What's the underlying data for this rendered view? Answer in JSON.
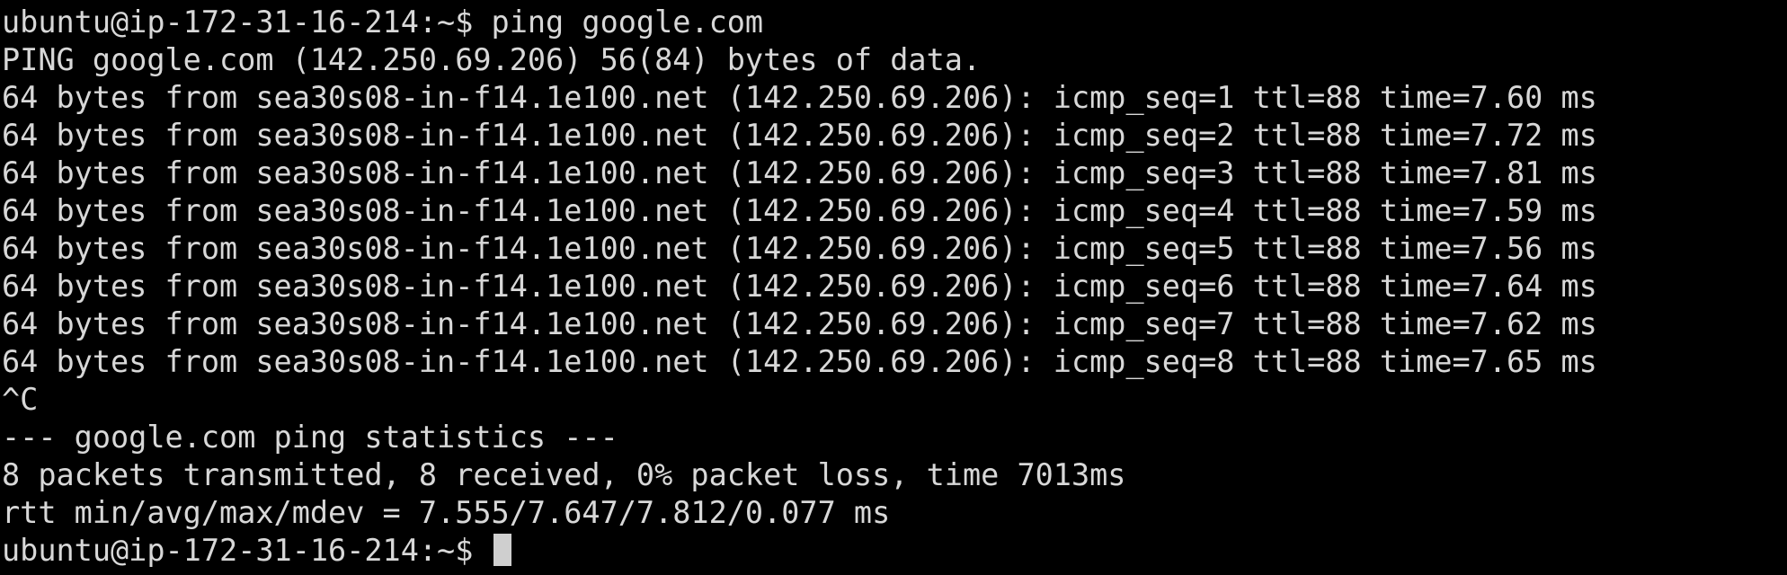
{
  "terminal": {
    "colors": {
      "background": "#000000",
      "foreground": "#d8d8d8",
      "cursor": "#cfcfcf"
    },
    "lines": [
      "ubuntu@ip-172-31-16-214:~$ ping google.com",
      "PING google.com (142.250.69.206) 56(84) bytes of data.",
      "64 bytes from sea30s08-in-f14.1e100.net (142.250.69.206): icmp_seq=1 ttl=88 time=7.60 ms",
      "64 bytes from sea30s08-in-f14.1e100.net (142.250.69.206): icmp_seq=2 ttl=88 time=7.72 ms",
      "64 bytes from sea30s08-in-f14.1e100.net (142.250.69.206): icmp_seq=3 ttl=88 time=7.81 ms",
      "64 bytes from sea30s08-in-f14.1e100.net (142.250.69.206): icmp_seq=4 ttl=88 time=7.59 ms",
      "64 bytes from sea30s08-in-f14.1e100.net (142.250.69.206): icmp_seq=5 ttl=88 time=7.56 ms",
      "64 bytes from sea30s08-in-f14.1e100.net (142.250.69.206): icmp_seq=6 ttl=88 time=7.64 ms",
      "64 bytes from sea30s08-in-f14.1e100.net (142.250.69.206): icmp_seq=7 ttl=88 time=7.62 ms",
      "64 bytes from sea30s08-in-f14.1e100.net (142.250.69.206): icmp_seq=8 ttl=88 time=7.65 ms",
      "^C",
      "--- google.com ping statistics ---",
      "8 packets transmitted, 8 received, 0% packet loss, time 7013ms",
      "rtt min/avg/max/mdev = 7.555/7.647/7.812/0.077 ms"
    ],
    "prompt": "ubuntu@ip-172-31-16-214:~$ "
  }
}
